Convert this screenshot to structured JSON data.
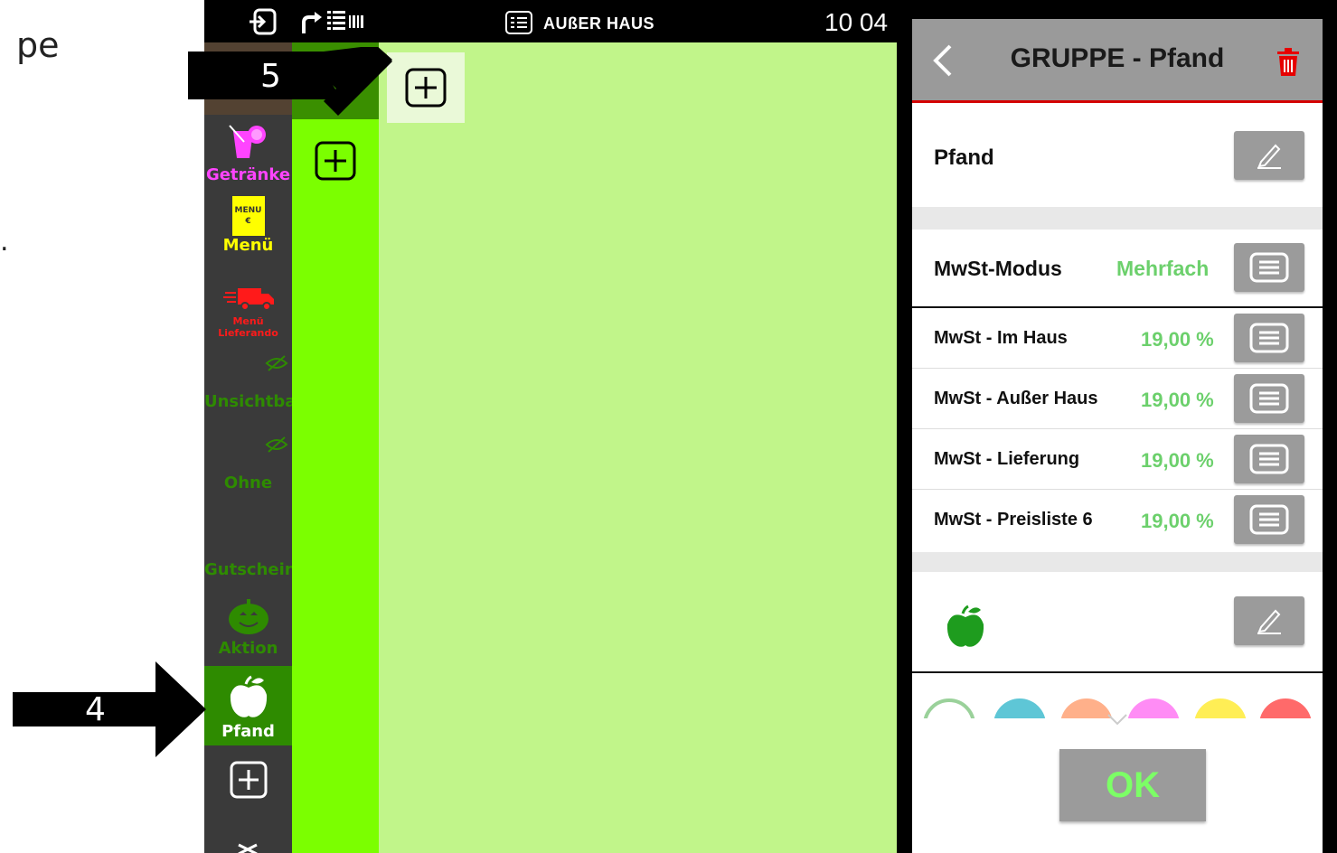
{
  "page_text": [
    "pe",
    "."
  ],
  "topbar": {
    "mode": "AUßER HAUS",
    "clock": "10 04"
  },
  "categories": [
    {
      "label": "Getränke",
      "color": "#ff44ff"
    },
    {
      "label": "Menü",
      "color": "#ffff00",
      "menu_badge": "MENU",
      "menu_currency": "€"
    },
    {
      "label": "Menü Lieferando",
      "color": "#ff1a1a"
    },
    {
      "label": "Unsichtbar",
      "color": "#2e8b00"
    },
    {
      "label": "Ohne",
      "color": "#2e8b00"
    },
    {
      "label": "Gutschein",
      "color": "#2e8b00"
    },
    {
      "label": "Aktion",
      "color": "#2e8b00"
    },
    {
      "label": "Pfand",
      "color": "#ffffff"
    }
  ],
  "callouts": {
    "arrow_5": "5",
    "arrow_4": "4"
  },
  "dialog": {
    "title": "GRUPPE - Pfand",
    "name": "Pfand",
    "mwst_mode_label": "MwSt-Modus",
    "mwst_mode_value": "Mehrfach",
    "tax_rows": [
      {
        "label": "MwSt - Im Haus",
        "value": "19,00 %"
      },
      {
        "label": "MwSt - Außer Haus",
        "value": "19,00 %"
      },
      {
        "label": "MwSt - Lieferung",
        "value": "19,00 %"
      },
      {
        "label": "MwSt - Preisliste 6",
        "value": "19,00 %"
      }
    ],
    "icon": "apple-icon",
    "swatch_colors": [
      "#ffffff",
      "#5ec6d6",
      "#ffb08a",
      "#ff8cf5",
      "#ffee55",
      "#ff6a6a"
    ],
    "ok_label": "OK"
  }
}
